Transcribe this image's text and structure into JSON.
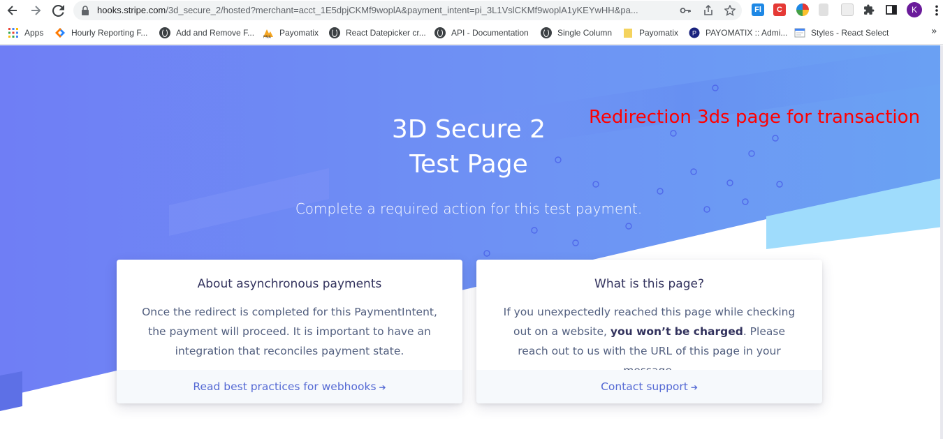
{
  "browser": {
    "url_host": "hooks.stripe.com",
    "url_path": "/3d_secure_2/hosted?merchant=acct_1E5dpjCKMf9woplA&payment_intent=pi_3L1VslCKMf9woplA1yKEYwHH&pa...",
    "profile_initial": "K",
    "extensions": [
      "Fl",
      "C"
    ],
    "colors": {
      "toolbar": "#ffffff",
      "omnibox": "#f1f3f4",
      "text": "#3c4043"
    }
  },
  "bookmarks": [
    {
      "label": "Apps",
      "icon": "apps-grid-icon"
    },
    {
      "label": "Hourly Reporting F...",
      "icon": "jira-icon"
    },
    {
      "label": "Add and Remove F...",
      "icon": "globe-icon"
    },
    {
      "label": "Payomatix",
      "icon": "payomatix-logo-icon"
    },
    {
      "label": "React Datepicker cr...",
      "icon": "globe-icon"
    },
    {
      "label": "API - Documentation",
      "icon": "globe-icon"
    },
    {
      "label": "Single Column",
      "icon": "globe-icon"
    },
    {
      "label": "Payomatix",
      "icon": "folder-icon"
    },
    {
      "label": "PAYOMATIX :: Admi...",
      "icon": "payomatix-admin-icon"
    },
    {
      "label": "Styles - React Select",
      "icon": "page-icon"
    }
  ],
  "bookmarks_more": "»",
  "hero": {
    "title_line1": "3D Secure 2",
    "title_line2": "Test Page",
    "subtitle": "Complete a required action for this test payment."
  },
  "annotation": "Redirection 3ds page for transaction",
  "cards": [
    {
      "title": "About asynchronous payments",
      "body": "Once the redirect is completed for this PaymentIntent, the payment will proceed. It is important to have an integration that reconciles payment state.",
      "link": "Read best practices for webhooks"
    },
    {
      "title": "What is this page?",
      "body_before": "If you unexpectedly reached this page while checking out on a website,",
      "body_bold": "you won’t be charged",
      "body_after": ". Please reach out to us with the URL of this page in your message.",
      "link": "Contact support"
    }
  ],
  "link_arrow": "➔",
  "colors": {
    "hero_gradient_start": "#6f7ef5",
    "hero_gradient_end": "#6aa2f3",
    "accent_light": "#9fdcfc",
    "link": "#5469d4",
    "heading": "#32325d",
    "body": "#525f7f",
    "annotation": "#ff0000"
  }
}
